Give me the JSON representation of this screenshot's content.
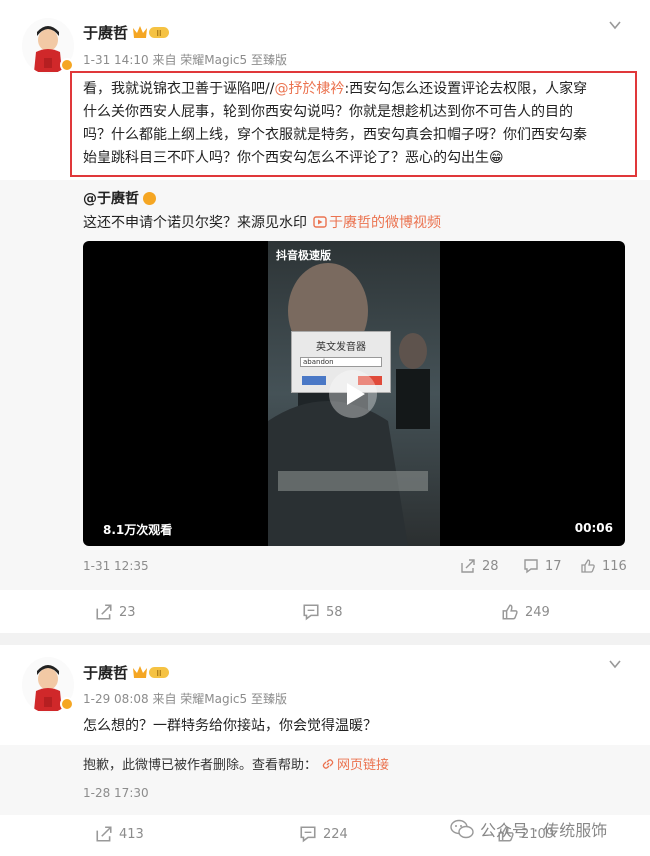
{
  "post1": {
    "username": "于赓哲",
    "meta": "1-31 14:10 来自 荣耀Magic5 至臻版",
    "text_line1_a": "看，我就说锦衣卫善于诬陷吧//",
    "text_line1_mention": "@抒於棣衿",
    "text_line1_b": ":西安勾怎么还设置评论去权限，人家穿",
    "text_line2": "什么关你西安人屁事，轮到你西安勾说吗？你就是想趁机达到你不可告人的目的",
    "text_line3": "吗？什么都能上纲上线，穿个衣服就是特务，西安勾真会扣帽子呀？你们西安勾秦",
    "text_line4": "始皇跳科目三不吓人吗？你个西安勾怎么不评论了？恶心的勾出生😁",
    "repost": {
      "username": "@于赓哲",
      "text": "这还不申请个诺贝尔奖？来源见水印",
      "video_link": "于赓哲的微博视频",
      "video_views": "8.1万次观看",
      "video_duration": "00:06",
      "video_watermark": "抖音极速版",
      "video_dialog_title": "英文发音器",
      "video_dialog_input": "abandon",
      "date": "1-31 12:35",
      "repost_count": "28",
      "comment_count": "17",
      "like_count": "116"
    },
    "repost_count": "23",
    "comment_count": "58",
    "like_count": "249"
  },
  "post2": {
    "username": "于赓哲",
    "meta": "1-29 08:08 来自 荣耀Magic5 至臻版",
    "text": "怎么想的？一群特务给你接站，你会觉得温暖？",
    "deleted_notice": "抱歉，此微博已被作者删除。查看帮助：",
    "deleted_link": "网页链接",
    "deleted_date": "1-28 17:30",
    "repost_count": "413",
    "comment_count": "224",
    "like_count": "2109"
  },
  "watermark": {
    "text": "公众号 · 传统服饰"
  },
  "colors": {
    "accent": "#eb7350",
    "highlight_box": "#e0383a",
    "vip_badge": "#f5a623"
  }
}
